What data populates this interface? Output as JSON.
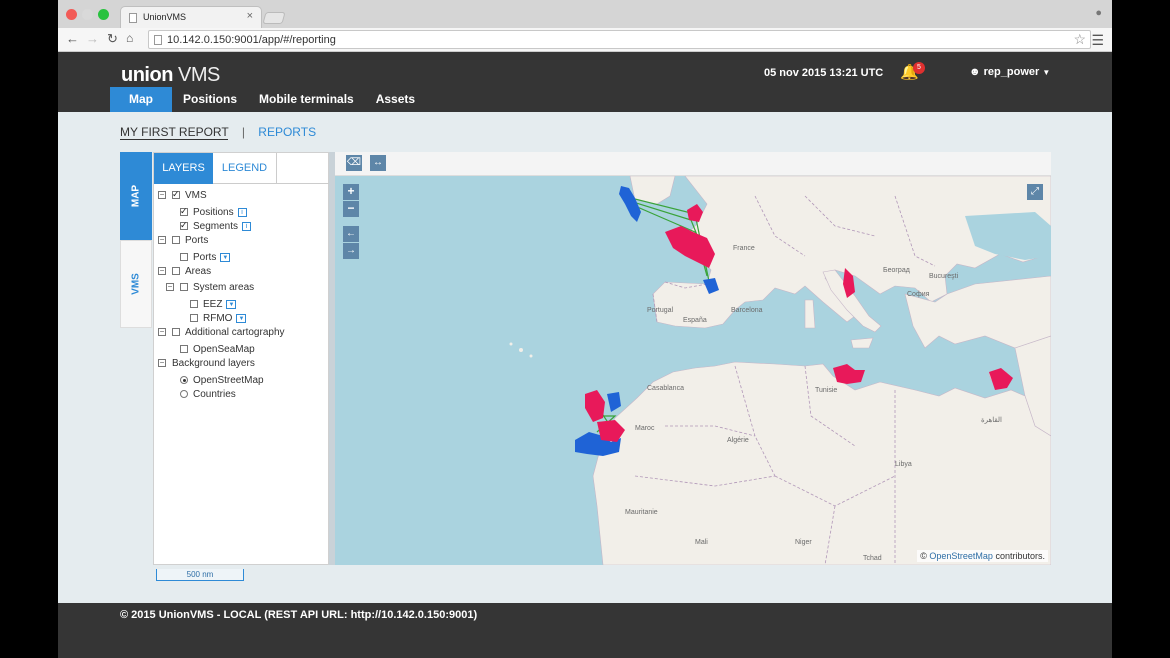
{
  "browser": {
    "tab_title": "UnionVMS",
    "tab_close": "×",
    "url": "10.142.0.150:9001/app/#/reporting"
  },
  "header": {
    "logo_bold": "union",
    "logo_rest": "VMS",
    "datetime": "05 nov 2015 13:21 UTC",
    "notification_count": "5",
    "user": "rep_power",
    "nav": [
      {
        "label": "Map",
        "active": true
      },
      {
        "label": "Positions"
      },
      {
        "label": "Mobile terminals"
      },
      {
        "label": "Assets"
      }
    ]
  },
  "breadcrumb": {
    "current": "MY FIRST REPORT",
    "separator": "|",
    "link": "REPORTS"
  },
  "side_tabs": {
    "map": "MAP",
    "vms": "VMS"
  },
  "panel": {
    "tab_layers": "LAYERS",
    "tab_legend": "LEGEND",
    "tree": {
      "vms": "VMS",
      "positions": "Positions",
      "segments": "Segments",
      "ports_group": "Ports",
      "ports": "Ports",
      "areas": "Areas",
      "system_areas": "System areas",
      "eez": "EEZ",
      "rfmo": "RFMO",
      "additional_cartography": "Additional cartography",
      "openseamap": "OpenSeaMap",
      "background_layers": "Background layers",
      "openstreetmap": "OpenStreetMap",
      "countries": "Countries"
    }
  },
  "map": {
    "attribution_prefix": "©",
    "attribution_link": "OpenStreetMap",
    "attribution_suffix": "contributors.",
    "scale": "500 nm",
    "zoom_in": "+",
    "zoom_out": "−",
    "colors": {
      "sea": "#aad3df",
      "land": "#f2efe9",
      "positions_red": "#e8195a",
      "positions_blue": "#1f63d6",
      "segments_green": "#3aa33a"
    },
    "place_labels": [
      "France",
      "España",
      "Portugal",
      "Maroc",
      "Algérie",
      "Tunisie",
      "Libya",
      "Mali",
      "Niger",
      "Tchad",
      "Mauritanie",
      "Barcelona",
      "Београд",
      "София",
      "Bucureşti",
      "Casablanca",
      "القاهرة"
    ]
  },
  "footer": {
    "text": "© 2015 UnionVMS - LOCAL   (REST API URL: http://10.142.0.150:9001)"
  }
}
